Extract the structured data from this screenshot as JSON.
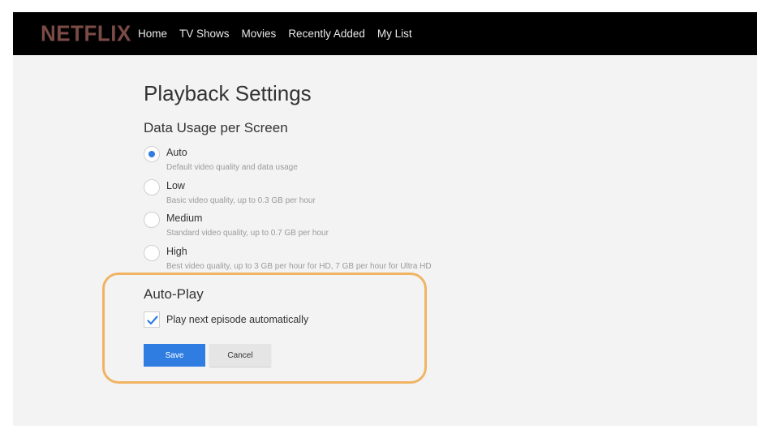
{
  "brand": {
    "logo_text": "NETFLIX",
    "logo_color": "#7a4a45"
  },
  "nav": {
    "items": [
      {
        "label": "Home"
      },
      {
        "label": "TV Shows"
      },
      {
        "label": "Movies"
      },
      {
        "label": "Recently Added"
      },
      {
        "label": "My List"
      }
    ]
  },
  "page": {
    "title": "Playback Settings"
  },
  "data_usage": {
    "title": "Data Usage per Screen",
    "selected": "Auto",
    "options": [
      {
        "label": "Auto",
        "description": "Default video quality and data usage",
        "checked": true
      },
      {
        "label": "Low",
        "description": "Basic video quality, up to 0.3 GB per hour",
        "checked": false
      },
      {
        "label": "Medium",
        "description": "Standard video quality, up to 0.7 GB per hour",
        "checked": false
      },
      {
        "label": "High",
        "description": "Best video quality, up to 3 GB per hour for HD, 7 GB per hour for Ultra HD",
        "checked": false
      }
    ]
  },
  "autoplay": {
    "title": "Auto-Play",
    "checkbox_label": "Play next episode automatically",
    "checked": true
  },
  "actions": {
    "save_label": "Save",
    "cancel_label": "Cancel"
  },
  "colors": {
    "accent": "#2f7de1",
    "highlight": "#f0b463",
    "topbar": "#000000"
  },
  "icons": {
    "autoplay_check": "checkmark-icon"
  }
}
